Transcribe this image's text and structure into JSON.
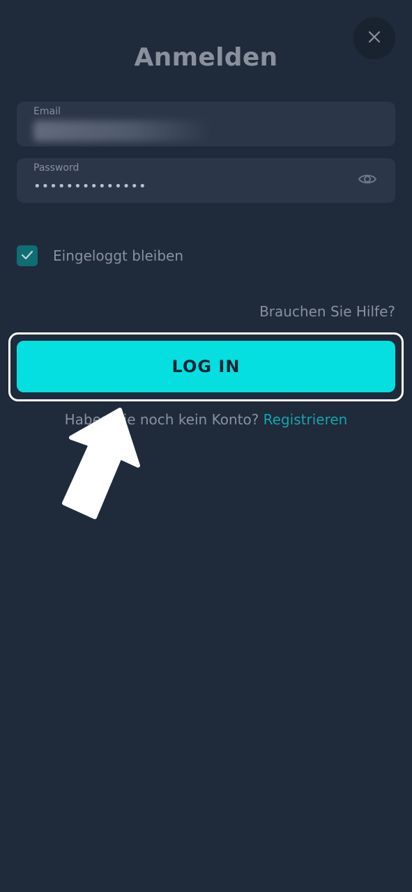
{
  "header": {
    "title": "Anmelden",
    "close_icon": "close-icon"
  },
  "form": {
    "email": {
      "label": "Email",
      "value_blurred": true
    },
    "password": {
      "label": "Password",
      "value": "••••••••••••••",
      "toggle_icon": "eye-icon"
    },
    "remember": {
      "label": "Eingeloggt bleiben",
      "checked": true
    },
    "help_link": "Brauchen Sie Hilfe?",
    "login_button": "LOG IN",
    "register_prompt": "Haben Sie noch kein Konto?",
    "register_link": "Registrieren"
  },
  "overlay": {
    "highlight": "login-button",
    "arrow_icon": "pointer-arrow"
  },
  "colors": {
    "background": "#1f2a3b",
    "field": "#2c3649",
    "accent": "#05dfe0",
    "link": "#12a6ab",
    "checkbox": "#0f6d73",
    "muted_text": "#8a919c"
  }
}
